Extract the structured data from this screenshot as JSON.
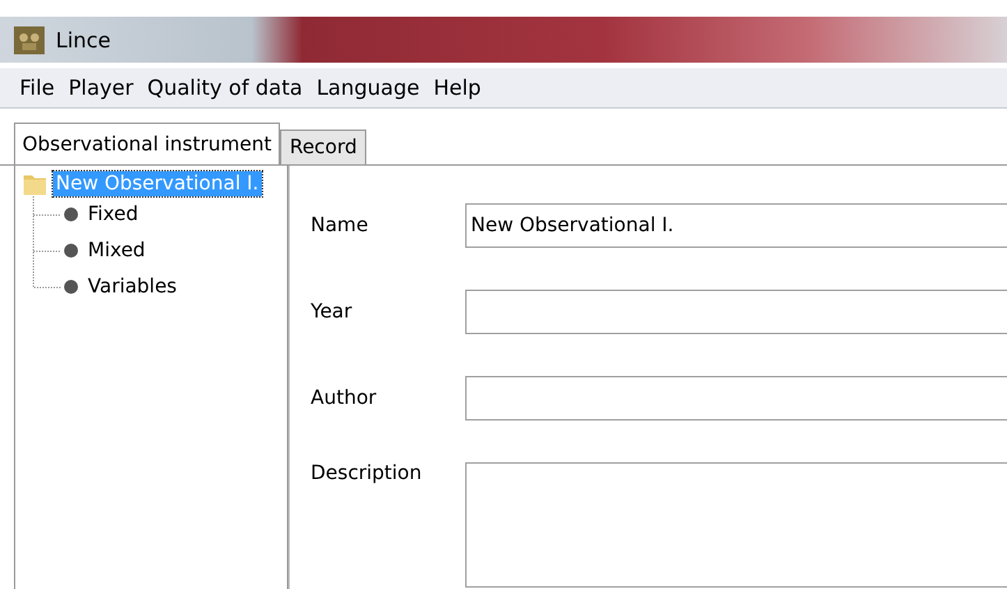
{
  "window": {
    "title": "Lince"
  },
  "menu": [
    "File",
    "Player",
    "Quality of data",
    "Language",
    "Help"
  ],
  "tabs": [
    {
      "label": "Observational instrument",
      "selected": true
    },
    {
      "label": "Record",
      "selected": false
    }
  ],
  "tree": {
    "label": "New Observational I.",
    "selected": true,
    "children": [
      {
        "label": "Fixed",
        "selected": false
      },
      {
        "label": "Mixed",
        "selected": false
      },
      {
        "label": "Variables",
        "selected": false
      }
    ]
  },
  "form": [
    {
      "label": "Name",
      "value": "New Observational I.",
      "kind": "line"
    },
    {
      "label": "Year",
      "kind": "line"
    },
    {
      "label": "Author",
      "kind": "line"
    },
    {
      "label": "Description",
      "kind": "area"
    }
  ]
}
